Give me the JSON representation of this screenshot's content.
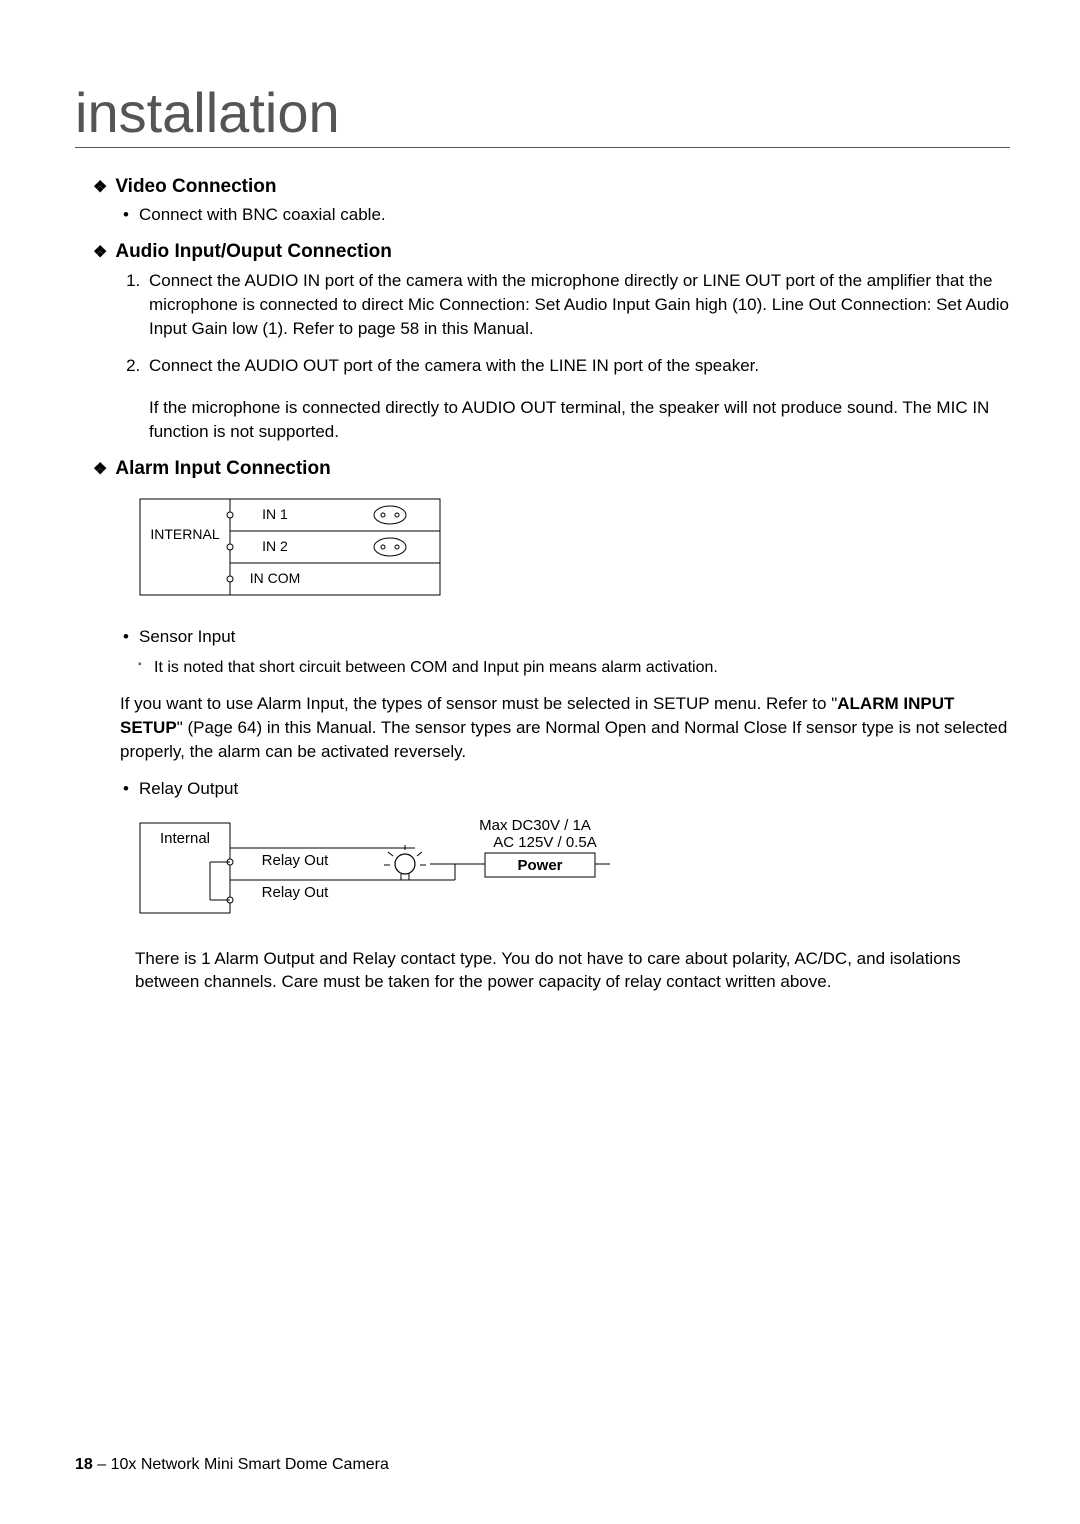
{
  "page_title": "installation",
  "sections": {
    "video": {
      "heading": "Video Connection",
      "bullet1": "Connect with BNC coaxial cable."
    },
    "audio": {
      "heading": "Audio Input/Ouput Connection",
      "item1": "Connect the AUDIO IN port of the camera with the microphone directly or LINE OUT port of the amplifier that the microphone is connected to direct Mic Connection: Set Audio Input Gain high (10). Line Out Connection: Set Audio Input Gain low (1). Refer to page 58 in this Manual.",
      "item2": "Connect the AUDIO OUT port of the camera with the LINE IN port of the speaker.",
      "item2b": "If the microphone is connected directly to AUDIO OUT terminal, the speaker will not produce sound. The MIC IN function is not supported."
    },
    "alarm": {
      "heading": "Alarm Input Connection",
      "diagram1": {
        "internal": "INTERNAL",
        "in1": "IN 1",
        "in2": "IN 2",
        "incom": "IN COM"
      },
      "sensor_label": "Sensor Input",
      "sensor_note": "It is noted that short circuit between COM and Input pin means alarm activation.",
      "alarm_para_prefix": "If you want to use Alarm Input, the types of sensor must be selected in SETUP menu. Refer to \"",
      "alarm_ref": "ALARM INPUT SETUP",
      "alarm_para_suffix": "\" (Page 64) in this Manual. The sensor types are Normal Open and Normal Close If sensor type is not selected properly, the alarm can be activated reversely.",
      "relay_label": "Relay Output",
      "diagram2": {
        "internal": "Internal",
        "relay1": "Relay Out",
        "relay2": "Relay Out",
        "max1": "Max DC30V / 1A",
        "max2": "AC 125V / 0.5A",
        "power": "Power"
      },
      "relay_para": "There is 1 Alarm Output and Relay contact type. You do not have to care about polarity, AC/DC, and isolations between channels. Care must be taken for the power capacity of relay contact written above."
    }
  },
  "footer": {
    "page_number": "18",
    "sep": " – ",
    "product": "10x Network Mini Smart Dome Camera"
  }
}
